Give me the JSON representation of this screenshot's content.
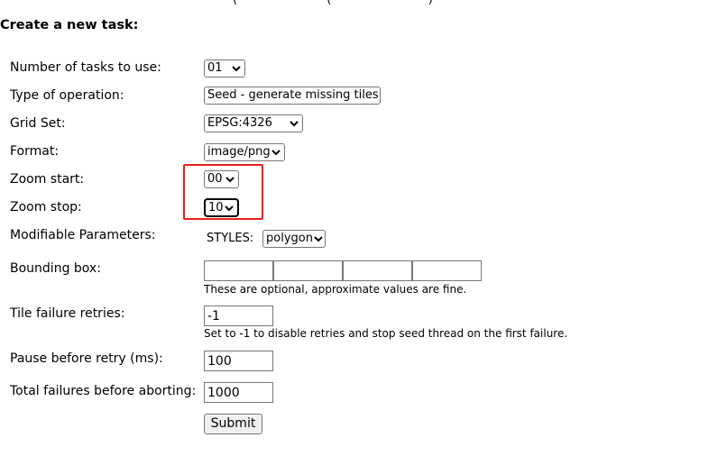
{
  "cut_top_text": "(                        (                          )",
  "title": "Create a new task:",
  "fields": {
    "num_tasks": {
      "label": "Number of tasks to use:",
      "value": "01"
    },
    "operation": {
      "label": "Type of operation:",
      "value": "Seed - generate missing tiles"
    },
    "grid_set": {
      "label": "Grid Set:",
      "value": "EPSG:4326"
    },
    "format": {
      "label": "Format:",
      "value": "image/png"
    },
    "zoom_start": {
      "label": "Zoom start:",
      "value": "00"
    },
    "zoom_stop": {
      "label": "Zoom stop:",
      "value": "10"
    },
    "modifiable": {
      "label": "Modifiable Parameters:",
      "styles_label": "STYLES:",
      "styles_value": "polygon"
    },
    "bbox": {
      "label": "Bounding box:",
      "hint": "These are optional, approximate values are fine.",
      "values": [
        "",
        "",
        "",
        ""
      ]
    },
    "tile_retries": {
      "label": "Tile failure retries:",
      "value": "-1",
      "hint": "Set to -1 to disable retries and stop seed thread on the first failure."
    },
    "pause": {
      "label": "Pause before retry (ms):",
      "value": "100"
    },
    "total_failures": {
      "label": "Total failures before aborting:",
      "value": "1000"
    }
  },
  "submit_label": "Submit",
  "colors": {
    "highlight": "#e8201e"
  },
  "icons": {
    "select_arrow": "chevron-down-icon"
  }
}
